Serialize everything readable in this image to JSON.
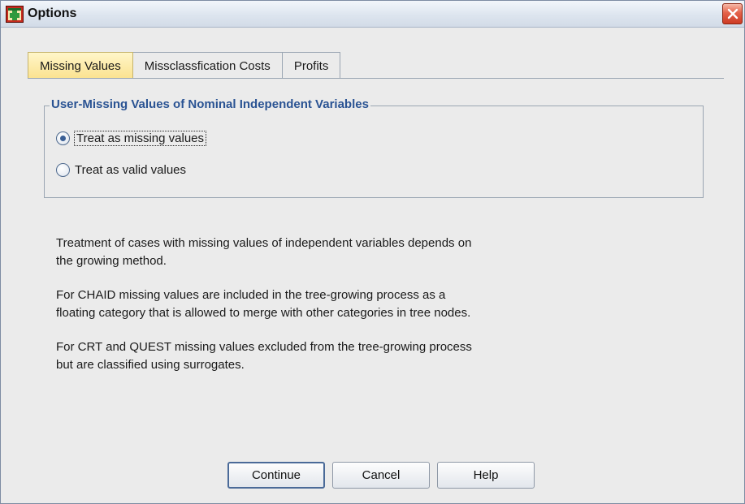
{
  "window": {
    "title": "Options",
    "icon": "spss-options-icon",
    "close_icon": "close-icon"
  },
  "tabs": [
    {
      "label": "Missing Values",
      "active": true
    },
    {
      "label": "Missclassfication Costs",
      "active": false
    },
    {
      "label": "Profits",
      "active": false
    }
  ],
  "group": {
    "title": "User-Missing Values of Nominal Independent Variables",
    "options": [
      {
        "label": "Treat as missing values",
        "mnemonic": "m",
        "selected": true
      },
      {
        "label": "Treat as valid values",
        "mnemonic": "v",
        "selected": false
      }
    ]
  },
  "description": {
    "p1_line1": "Treatment of cases with missing values of independent variables depends on",
    "p1_line2": "the growing method.",
    "p2_line1": "For CHAID missing values are included in the tree-growing process as a",
    "p2_line2": "floating category that is allowed to merge with other categories in tree nodes.",
    "p3_line1": "For CRT and QUEST missing values excluded from the tree-growing process",
    "p3_line2": "but are classified using surrogates."
  },
  "buttons": {
    "continue": "Continue",
    "cancel": "Cancel",
    "help": "Help"
  },
  "colors": {
    "active_tab": "#fbe28f",
    "group_title": "#2a5393",
    "close_button": "#e4624a"
  }
}
